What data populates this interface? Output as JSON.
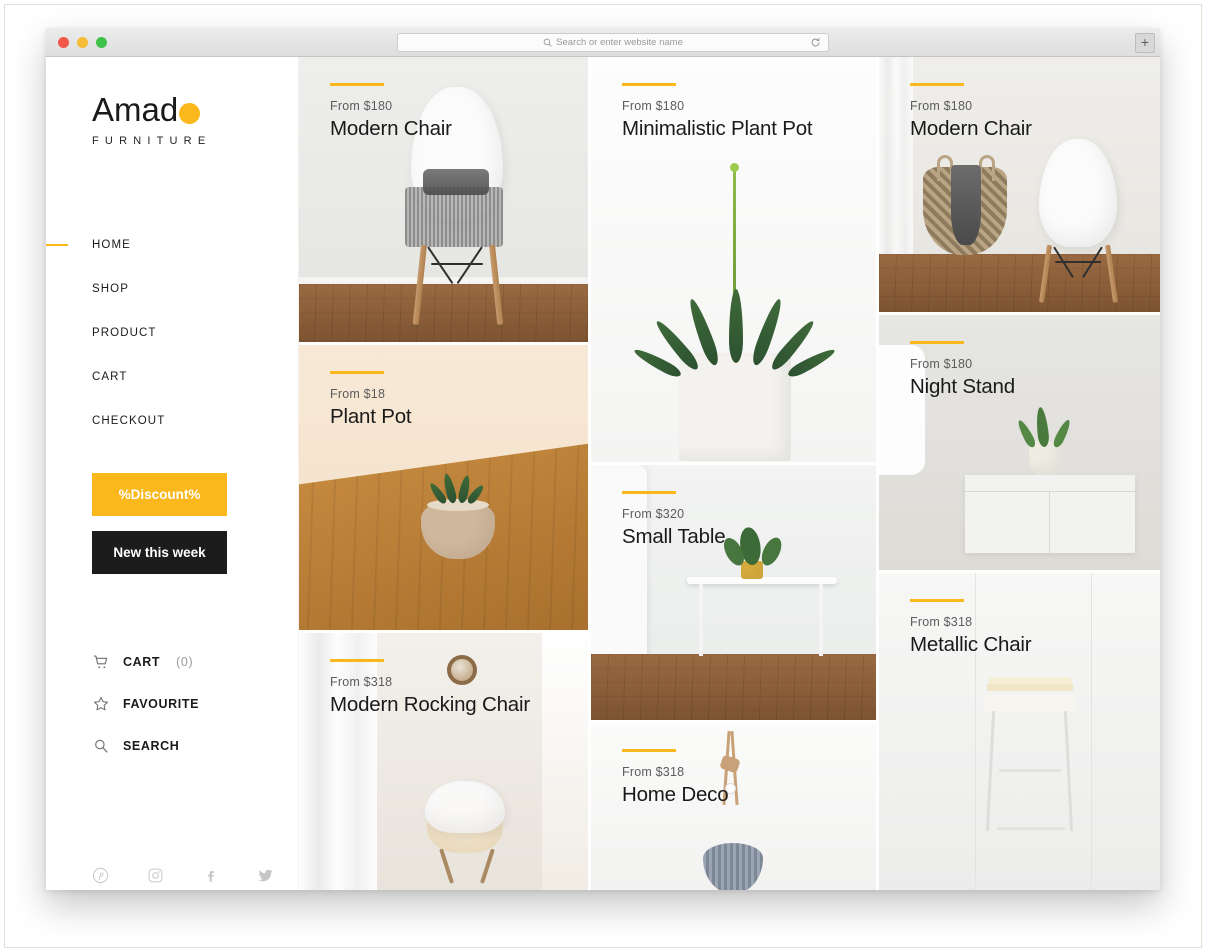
{
  "browser": {
    "address_placeholder": "Search or enter website name",
    "new_tab_label": "+",
    "traffic_lights": [
      "close",
      "minimize",
      "maximize"
    ]
  },
  "colors": {
    "accent_yellow": "#fbb81c",
    "dark_button": "#1c1c1c",
    "text_dark": "#1a1a1a",
    "text_muted": "#5c5c5c"
  },
  "sidebar": {
    "logo": {
      "name": "Amad",
      "dot_icon": "circle-dot",
      "tagline": "FURNITURE"
    },
    "nav": [
      {
        "label": "HOME",
        "active": true
      },
      {
        "label": "SHOP",
        "active": false
      },
      {
        "label": "PRODUCT",
        "active": false
      },
      {
        "label": "CART",
        "active": false
      },
      {
        "label": "CHECKOUT",
        "active": false
      }
    ],
    "buttons": {
      "discount": "%Discount%",
      "new_this_week": "New this week"
    },
    "utilities": [
      {
        "label": "CART",
        "count": "(0)",
        "icon": "cart-icon"
      },
      {
        "label": "FAVOURITE",
        "count": "",
        "icon": "star-icon"
      },
      {
        "label": "SEARCH",
        "count": "",
        "icon": "search-icon"
      }
    ],
    "social": [
      "pinterest-icon",
      "instagram-icon",
      "facebook-icon",
      "twitter-icon"
    ]
  },
  "products": {
    "column_1": [
      {
        "price": "From $180",
        "title": "Modern Chair",
        "scene": "chair-shoes"
      },
      {
        "price": "From $18",
        "title": "Plant Pot",
        "scene": "plant-table"
      },
      {
        "price": "From $318",
        "title": "Modern Rocking Chair",
        "scene": "rocking-chair"
      }
    ],
    "column_2": [
      {
        "price": "From $180",
        "title": "Minimalistic Plant Pot",
        "scene": "aloe-pot"
      },
      {
        "price": "From $320",
        "title": "Small Table",
        "scene": "small-table"
      },
      {
        "price": "From $318",
        "title": "Home Deco",
        "scene": "home-deco"
      }
    ],
    "column_3": [
      {
        "price": "From $180",
        "title": "Modern Chair",
        "scene": "chair-basket"
      },
      {
        "price": "From $180",
        "title": "Night Stand",
        "scene": "night-stand"
      },
      {
        "price": "From $318",
        "title": "Metallic Chair",
        "scene": "metallic-chair"
      }
    ]
  }
}
